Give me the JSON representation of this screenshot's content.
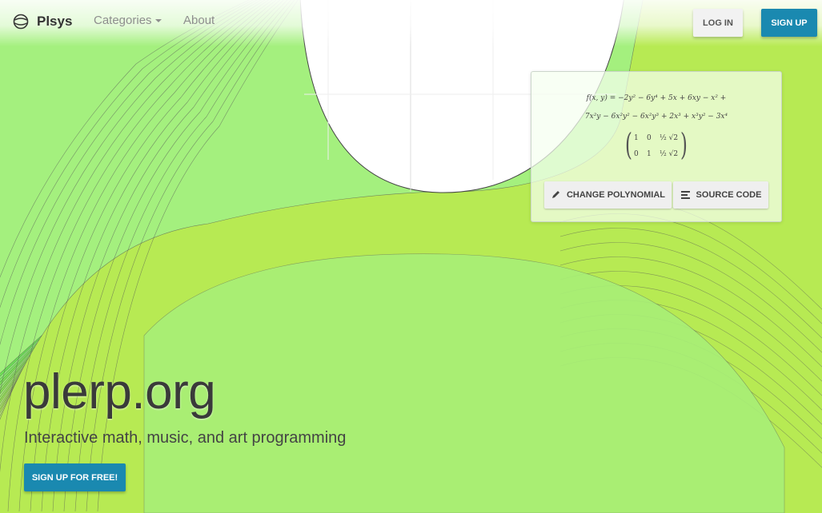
{
  "brand": {
    "name": "Plsys",
    "icon": "globe-icon"
  },
  "nav": {
    "categories_label": "Categories",
    "about_label": "About"
  },
  "auth": {
    "login_label": "LOG IN",
    "signup_label": "SIGN UP"
  },
  "formula_card": {
    "line1": "f(x, y) = −2y² − 6y⁴ + 5x + 6xy − x² +",
    "line2": "7x²y − 6x²y² − 6x²y³ + 2x³ + x³y² − 3x⁴",
    "matrix": [
      [
        "1",
        "0",
        "½ √2"
      ],
      [
        "0",
        "1",
        "½ √2"
      ]
    ],
    "change_label": "CHANGE POLYNOMIAL",
    "source_label": "SOURCE CODE",
    "change_icon": "pencil-icon",
    "source_icon": "align-left-icon"
  },
  "hero": {
    "title": "plerp.org",
    "subtitle": "Interactive math, music, and art programming",
    "cta_label": "SIGN UP FOR FREE!"
  },
  "colors": {
    "accent": "#1a89b0",
    "background_green": "#a4f07e",
    "contour_line": "#555555",
    "contour_pale": "#d8f9c0"
  }
}
